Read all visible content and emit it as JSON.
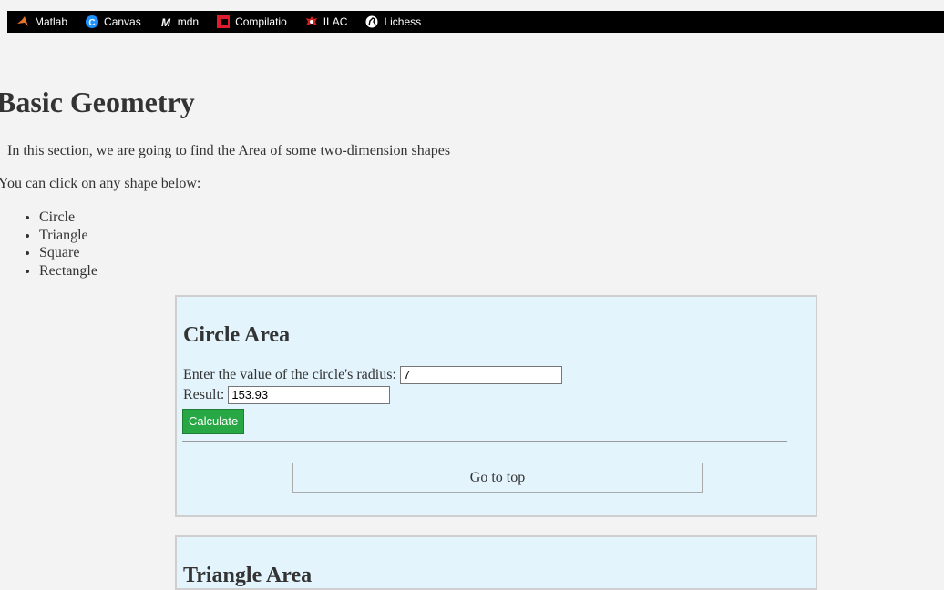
{
  "bookmarks": [
    {
      "label": "Matlab",
      "icon": "matlab-icon"
    },
    {
      "label": "Canvas",
      "icon": "canvas-icon"
    },
    {
      "label": "mdn",
      "icon": "mdn-icon"
    },
    {
      "label": "Compilatio",
      "icon": "compilatio-icon"
    },
    {
      "label": "ILAC",
      "icon": "ilac-icon"
    },
    {
      "label": "Lichess",
      "icon": "lichess-icon"
    }
  ],
  "page": {
    "title": "Basic Geometry",
    "intro": "In this section, we are going to find the Area of some two-dimension shapes",
    "instruction": "You can click on any shape below:",
    "shapes": [
      "Circle",
      "Triangle",
      "Square",
      "Rectangle"
    ]
  },
  "circle": {
    "heading": "Circle Area",
    "radius_label": "Enter the value of the circle's radius:",
    "radius_value": "7",
    "result_label": "Result:",
    "result_value": "153.93",
    "calculate_label": "Calculate",
    "top_label": "Go to top"
  },
  "triangle": {
    "heading": "Triangle Area"
  },
  "colors": {
    "card_bg": "#e3f4fd",
    "calculate_bg": "#28a745",
    "page_bg": "#f3f3f3"
  }
}
